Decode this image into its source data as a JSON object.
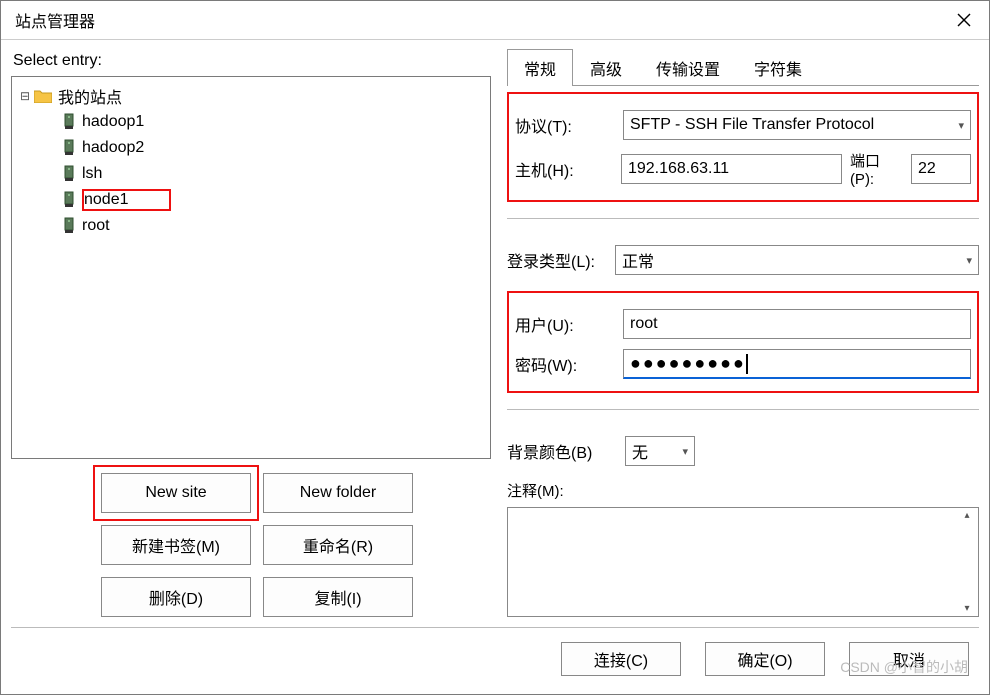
{
  "window": {
    "title": "站点管理器"
  },
  "left": {
    "label": "Select entry:",
    "root": "我的站点",
    "sites": [
      "hadoop1",
      "hadoop2",
      "lsh",
      "node1",
      "root"
    ],
    "selected": "node1",
    "buttons": {
      "new_site": "New site",
      "new_folder": "New folder",
      "new_bookmark": "新建书签(M)",
      "rename": "重命名(R)",
      "delete": "删除(D)",
      "copy": "复制(I)"
    }
  },
  "tabs": [
    "常规",
    "高级",
    "传输设置",
    "字符集"
  ],
  "active_tab": "常规",
  "form": {
    "protocol_label": "协议(T):",
    "protocol_value": "SFTP - SSH File Transfer Protocol",
    "host_label": "主机(H):",
    "host_value": "192.168.63.11",
    "port_label": "端口(P):",
    "port_value": "22",
    "logon_label": "登录类型(L):",
    "logon_value": "正常",
    "user_label": "用户(U):",
    "user_value": "root",
    "pass_label": "密码(W):",
    "pass_value": "●●●●●●●●●",
    "bgcolor_label": "背景颜色(B)",
    "bgcolor_value": "无",
    "comment_label": "注释(M):"
  },
  "footer": {
    "connect": "连接(C)",
    "ok": "确定(O)",
    "cancel": "取消"
  },
  "watermark": "CSDN @小智的小胡"
}
